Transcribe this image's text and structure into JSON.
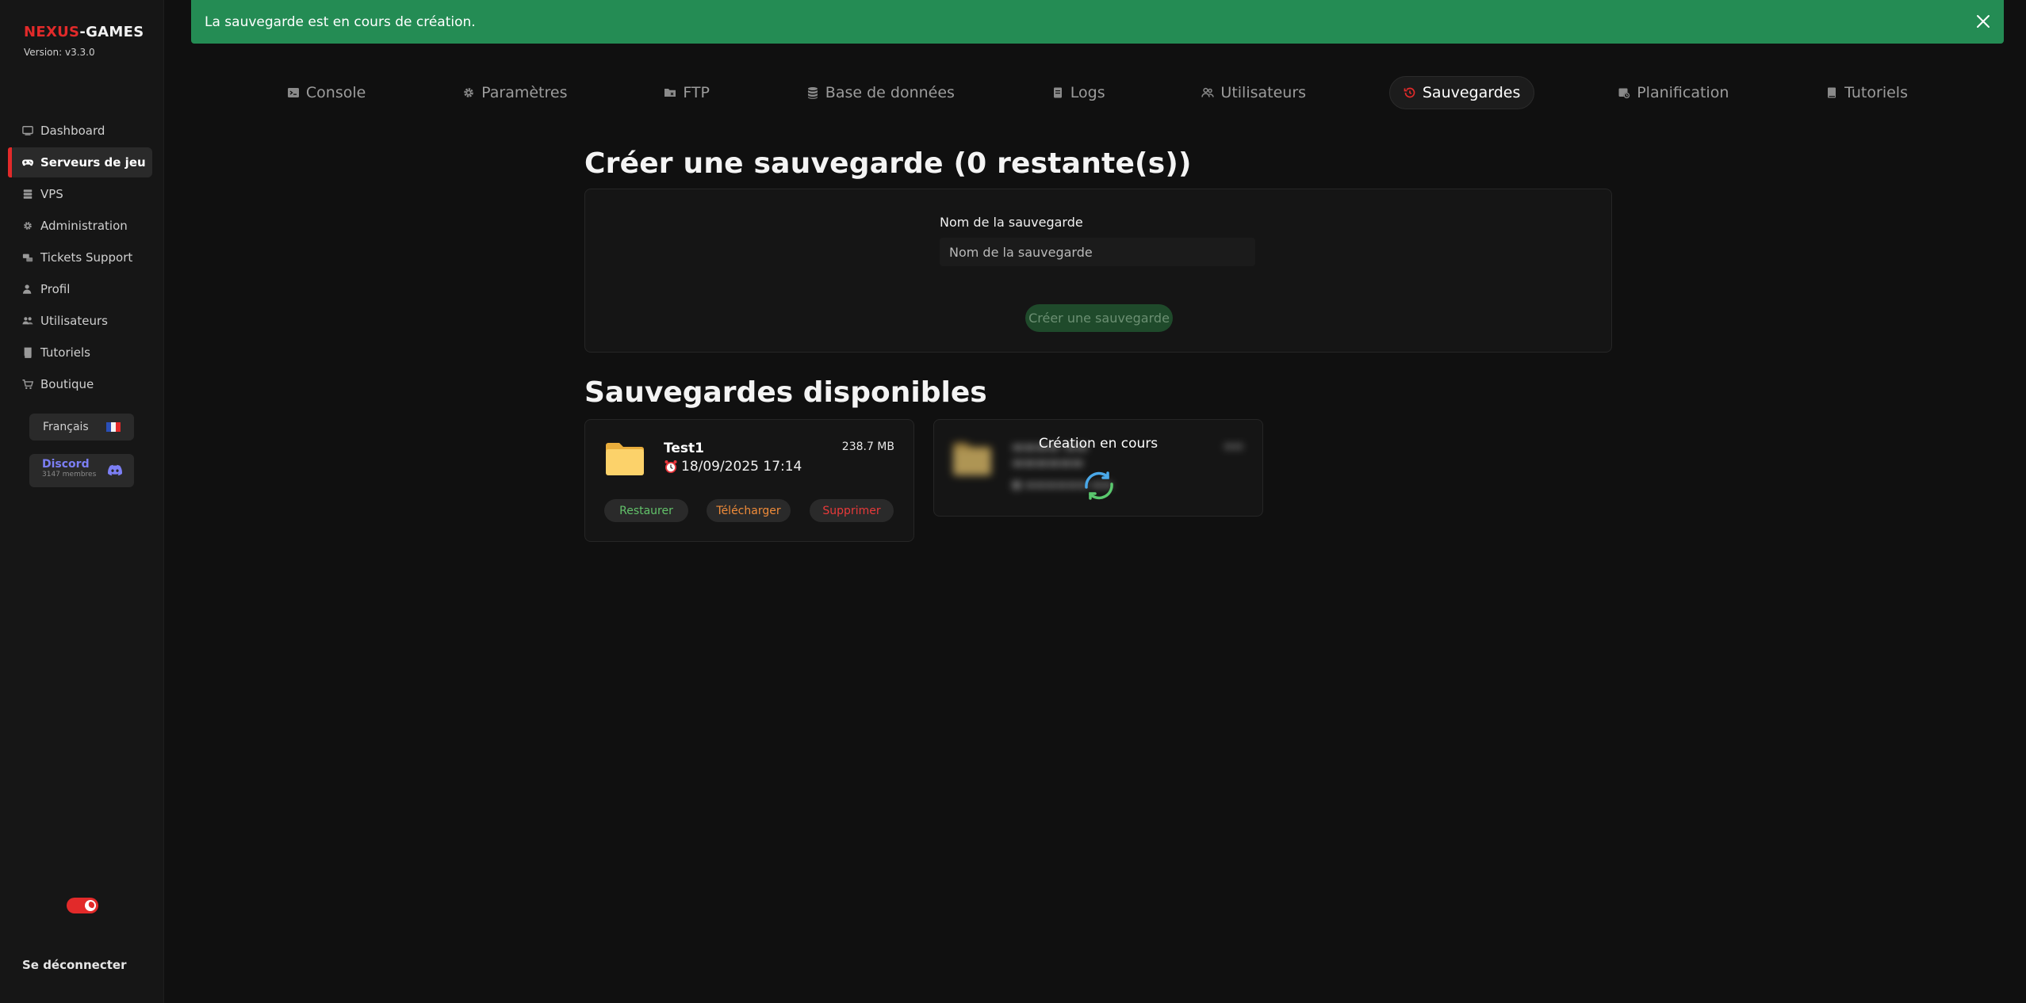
{
  "brand": {
    "part1": "NEXUS",
    "part2": "-GAMES",
    "version": "Version: v3.3.0"
  },
  "colors": {
    "accent": "#e22a2a",
    "success": "#248c54",
    "discord": "#7c7ff5"
  },
  "sidebar": {
    "items": [
      {
        "label": "Dashboard",
        "icon": "dashboard-icon"
      },
      {
        "label": "Serveurs de jeu",
        "icon": "gamepad-icon"
      },
      {
        "label": "VPS",
        "icon": "server-icon"
      },
      {
        "label": "Administration",
        "icon": "gear-icon"
      },
      {
        "label": "Tickets Support",
        "icon": "ticket-icon"
      },
      {
        "label": "Profil",
        "icon": "user-icon"
      },
      {
        "label": "Utilisateurs",
        "icon": "users-icon"
      },
      {
        "label": "Tutoriels",
        "icon": "book-icon"
      },
      {
        "label": "Boutique",
        "icon": "cart-icon"
      }
    ],
    "language": "Français",
    "discord": {
      "title": "Discord",
      "members": "3147 membres"
    },
    "logout": "Se déconnecter"
  },
  "toast": {
    "message": "La sauvegarde est en cours de création."
  },
  "tabs": [
    {
      "label": "Console",
      "icon": "terminal-icon"
    },
    {
      "label": "Paramètres",
      "icon": "gear-icon"
    },
    {
      "label": "FTP",
      "icon": "folder-icon"
    },
    {
      "label": "Base de données",
      "icon": "database-icon"
    },
    {
      "label": "Logs",
      "icon": "file-icon"
    },
    {
      "label": "Utilisateurs",
      "icon": "users-icon"
    },
    {
      "label": "Sauvegardes",
      "icon": "backup-icon"
    },
    {
      "label": "Planification",
      "icon": "calendar-icon"
    },
    {
      "label": "Tutoriels",
      "icon": "book-icon"
    }
  ],
  "create": {
    "title": "Créer une sauvegarde (0 restante(s))",
    "field_label": "Nom de la sauvegarde",
    "placeholder": "Nom de la sauvegarde",
    "button": "Créer une sauvegarde"
  },
  "available": {
    "title": "Sauvegardes disponibles",
    "backups": [
      {
        "name": "Test1",
        "date": "18/09/2025 17:14",
        "size": "238.7 MB",
        "restore": "Restaurer",
        "download": "Télécharger",
        "delete": "Supprimer"
      }
    ],
    "pending": {
      "label": "Création en cours"
    }
  }
}
